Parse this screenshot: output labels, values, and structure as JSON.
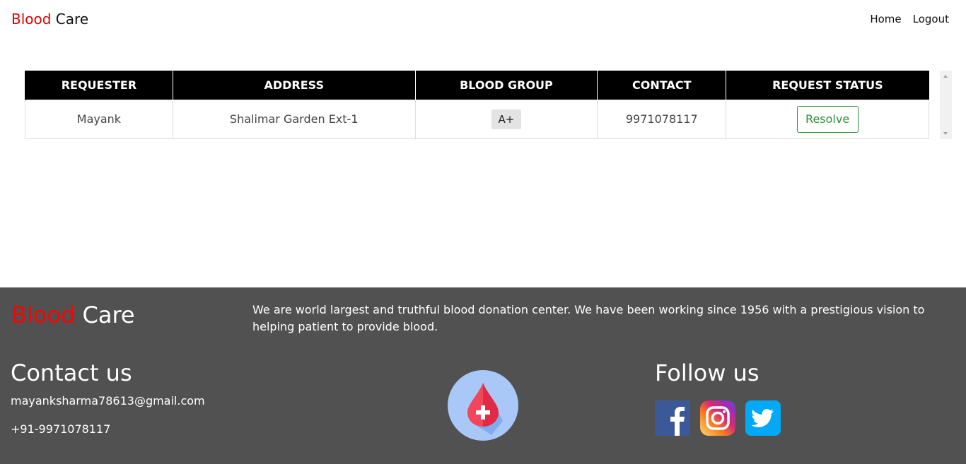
{
  "header": {
    "brand_red": "Blood",
    "brand_rest": " Care",
    "nav": {
      "home": "Home",
      "logout": "Logout"
    }
  },
  "table": {
    "columns": [
      "REQUESTER",
      "ADDRESS",
      "BLOOD GROUP",
      "CONTACT",
      "REQUEST STATUS"
    ],
    "rows": [
      {
        "requester": "Mayank",
        "address": "Shalimar Garden Ext-1",
        "blood_group": "A+",
        "contact": "9971078117",
        "status_action": "Resolve"
      }
    ]
  },
  "footer": {
    "brand_red": "Blood",
    "brand_rest": " Care",
    "about": "We are world largest and truthful blood donation center. We have been working since 1956 with a prestigious vision to helping patient to provide blood.",
    "contact_title": "Contact us",
    "email": "mayanksharma78613@gmail.com",
    "phone": "+91-9971078117",
    "follow_title": "Follow us"
  },
  "icons": {
    "logo": "blood-drop-plus-icon",
    "social": [
      "facebook-icon",
      "instagram-icon",
      "twitter-icon"
    ]
  },
  "colors": {
    "brand_red": "#e00000",
    "header_black": "#000000",
    "footer_gray": "#515151",
    "resolve_green": "#2f8f3b"
  }
}
